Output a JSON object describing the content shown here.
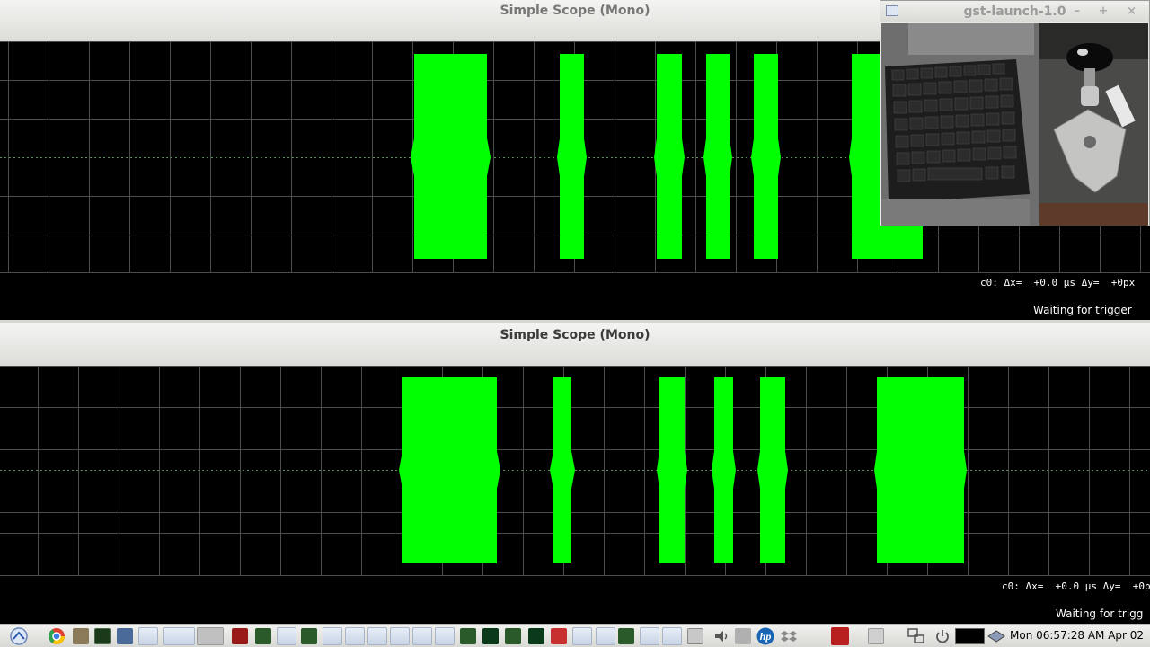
{
  "scope_top": {
    "title": "Simple Scope (Mono)",
    "cursor_readout": "c0: Δx=  +0.0 µs Δy=  +0px",
    "status": "Waiting for trigger"
  },
  "scope_bottom": {
    "title": "Simple Scope (Mono)",
    "cursor_readout": "c0: Δx=  +0.0 µs Δy=  +0p",
    "status": "Waiting for trigg"
  },
  "webcam": {
    "title": "gst-launch-1.0",
    "controls": "– + ×"
  },
  "taskbar": {
    "clock": "Mon 06:57:28 AM Apr 02",
    "hp_label": "hp"
  },
  "colors": {
    "trace": "#00ff00",
    "grid": "#4d4d4d",
    "background": "#000000"
  }
}
